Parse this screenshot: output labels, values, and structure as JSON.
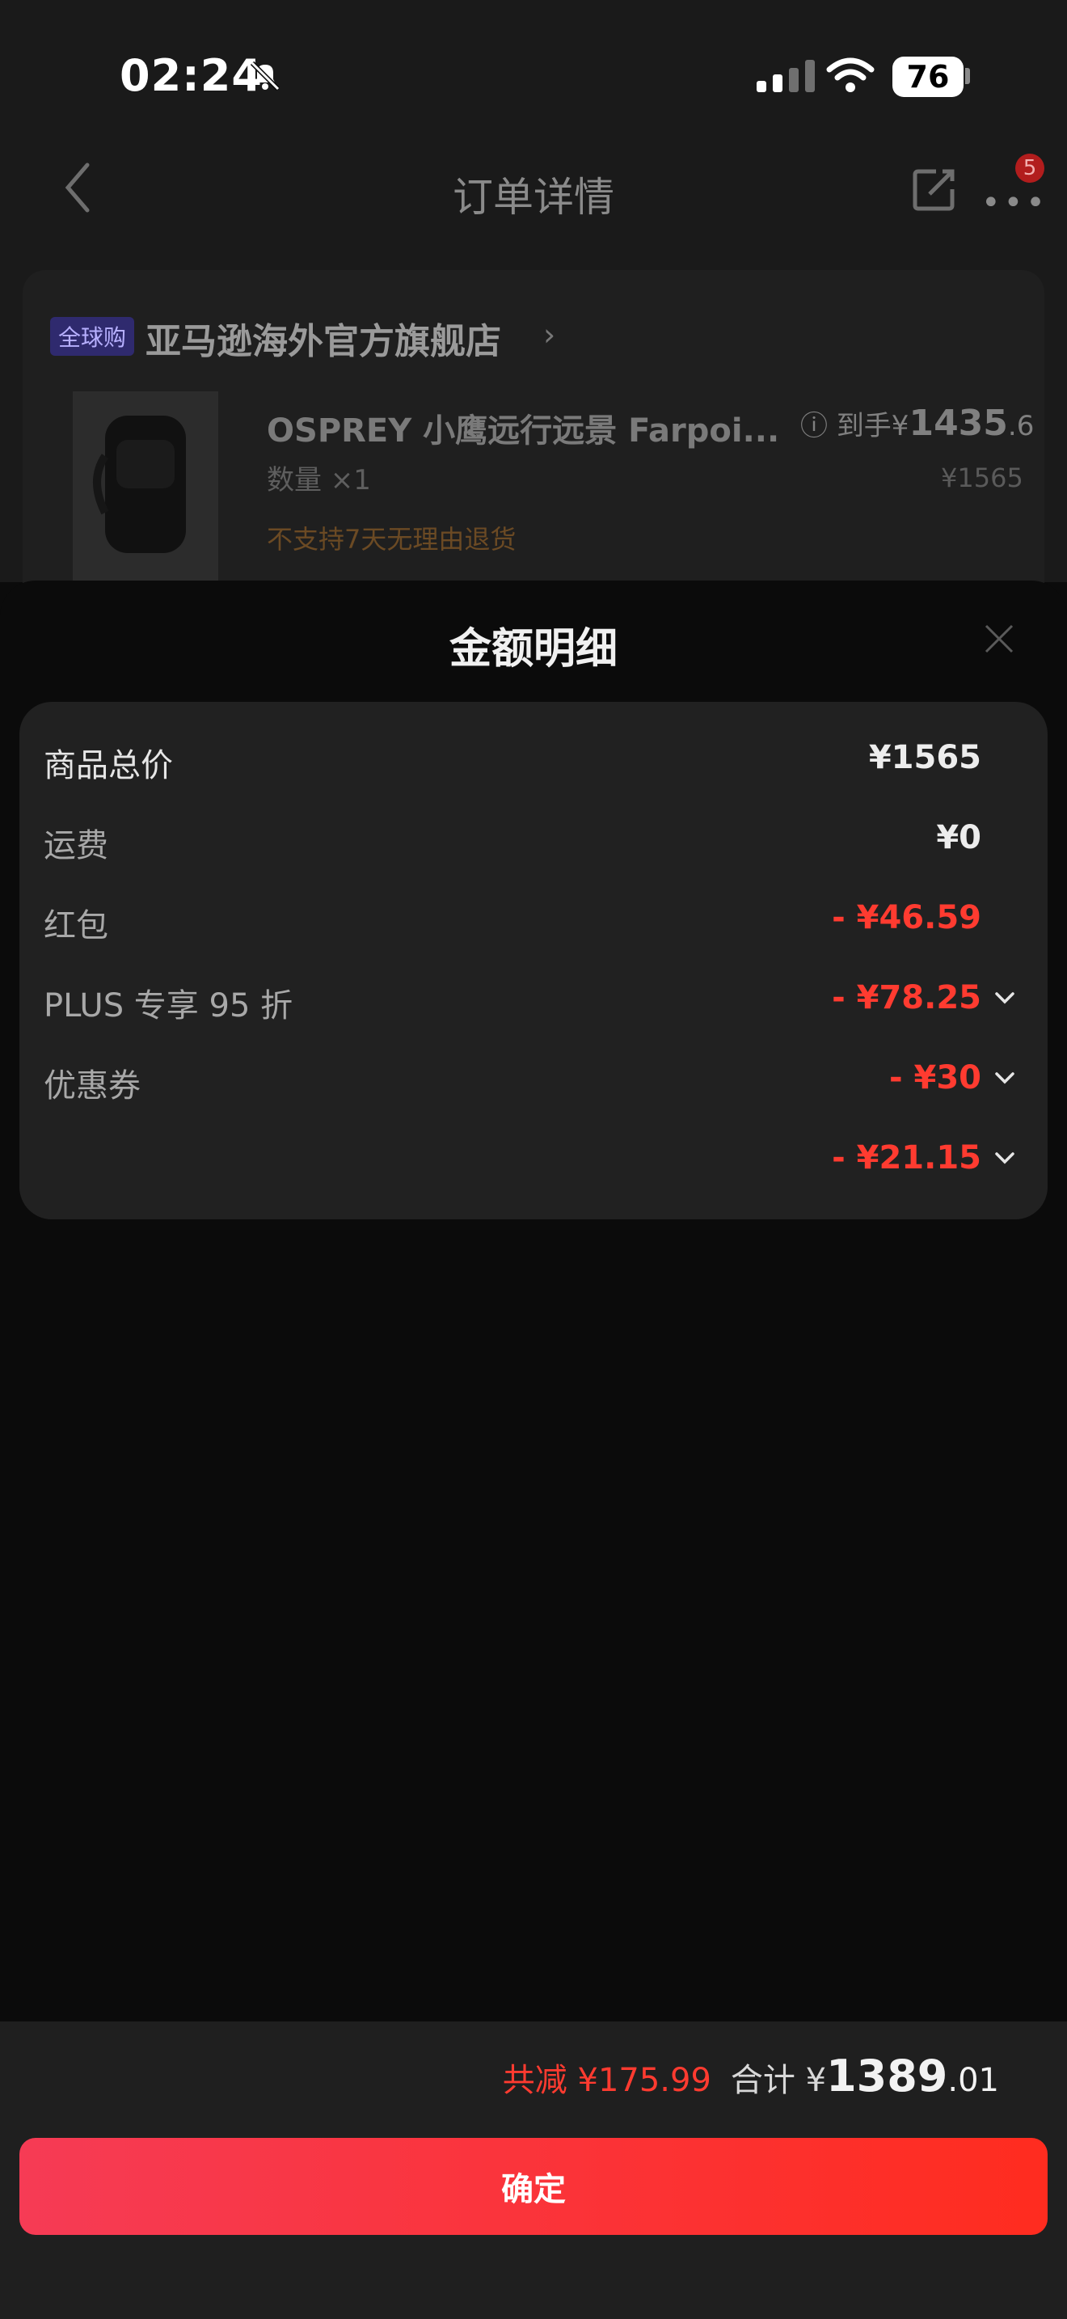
{
  "status": {
    "time": "02:24",
    "battery": "76"
  },
  "nav": {
    "title": "订单详情",
    "badge": "5"
  },
  "store": {
    "tag": "全球购",
    "name": "亚马逊海外官方旗舰店",
    "product_title": "OSPREY 小鹰远行远景 Farpoi...",
    "quantity": "数量 ×1",
    "return_note": "不支持7天无理由退货",
    "price_prefix": "到手¥",
    "price_int": "1435",
    "price_dec": ".6",
    "original_price": "¥1565"
  },
  "sheet": {
    "title": "金额明细",
    "rows": [
      {
        "label": "商品总价",
        "value": "¥1565"
      },
      {
        "label": "运费",
        "value": "¥0"
      },
      {
        "label": "红包",
        "value": "- ¥46.59"
      },
      {
        "label": "PLUS 专享 95 折",
        "value": "- ¥78.25"
      },
      {
        "label": "优惠券",
        "value": "- ¥30"
      },
      {
        "label": "",
        "value": "- ¥21.15"
      }
    ]
  },
  "summary": {
    "saved": "共减 ¥175.99",
    "total_label": "合计 ¥",
    "total_int": "1389",
    "total_dec": ".01"
  },
  "confirm_label": "确定",
  "colors": {
    "accent_red": "#ff3b30",
    "button_gradient_start": "#f63b55",
    "button_gradient_end": "#ff2c1f"
  }
}
